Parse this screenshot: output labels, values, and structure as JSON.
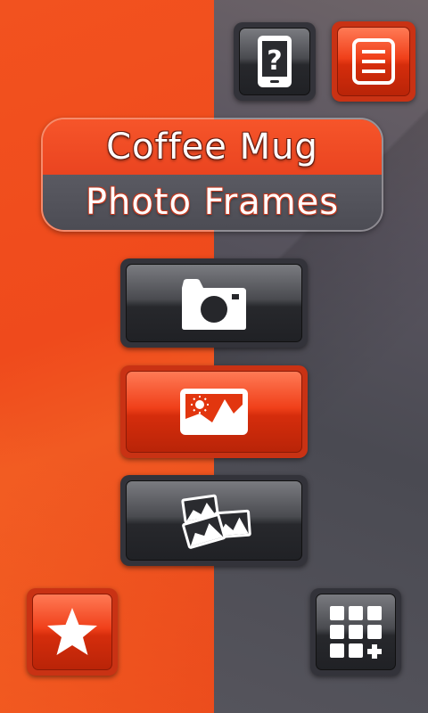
{
  "title": {
    "line1": "Coffee Mug",
    "line2": "Photo Frames"
  },
  "colors": {
    "accent_orange": "#f04a1c",
    "dark_gray": "#4d4d55",
    "button_dark": "#2a2b2f",
    "button_red": "#e2360f"
  },
  "buttons": {
    "help": {
      "icon": "phone-help-icon"
    },
    "menu": {
      "icon": "menu-list-icon"
    },
    "camera": {
      "icon": "camera-icon"
    },
    "gallery": {
      "icon": "gallery-image-icon"
    },
    "my_frames": {
      "icon": "photo-stack-icon"
    },
    "rate": {
      "icon": "star-icon"
    },
    "more_apps": {
      "icon": "grid-add-icon"
    }
  }
}
